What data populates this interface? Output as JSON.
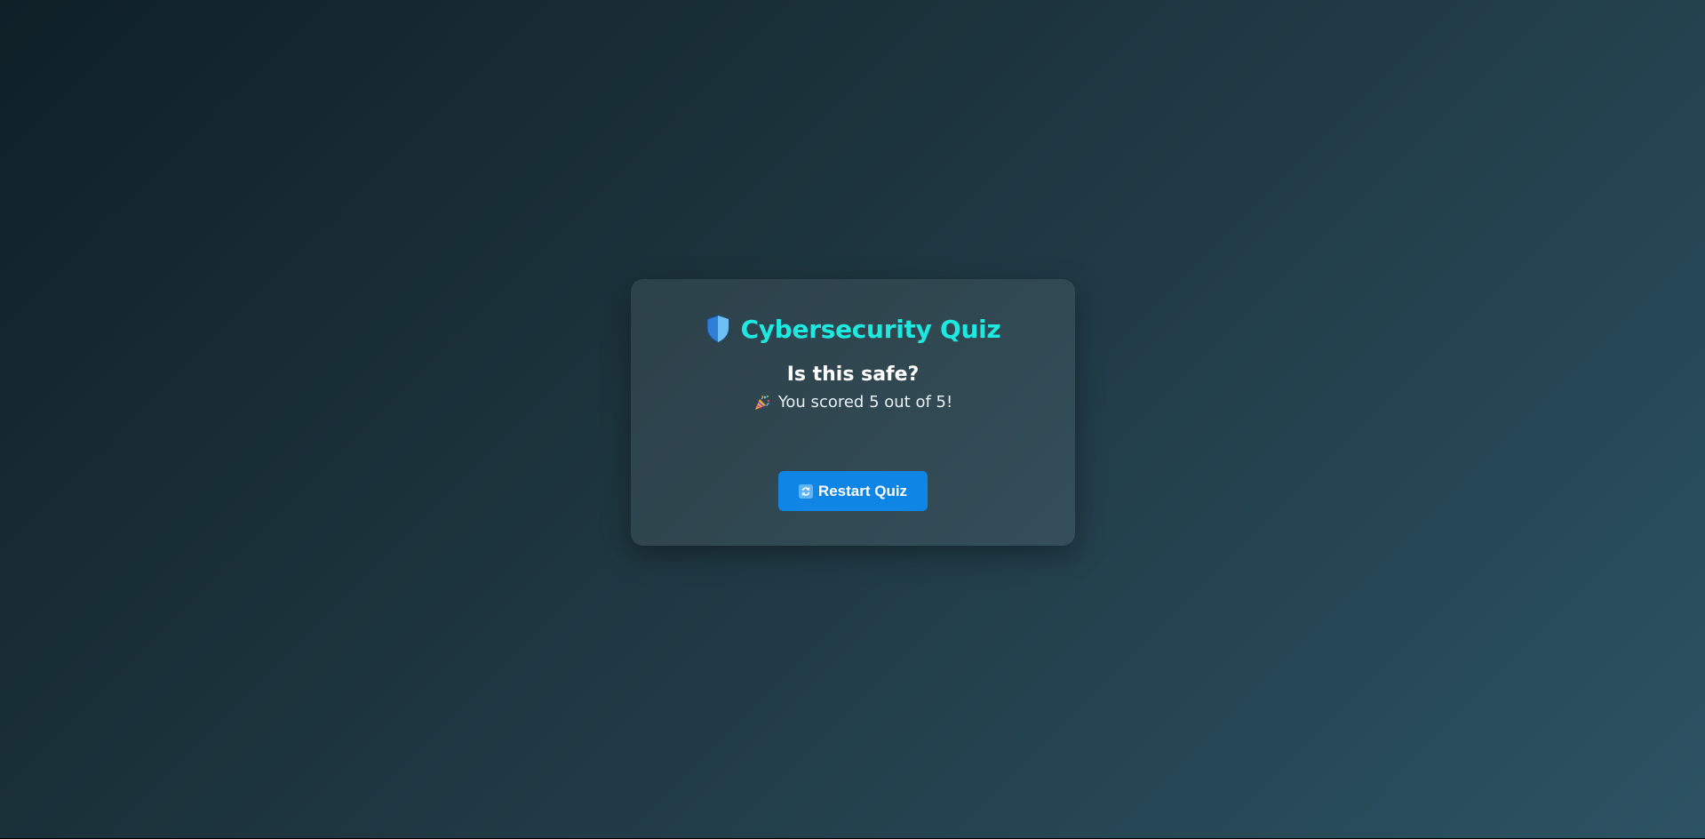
{
  "app": {
    "title": "Cybersecurity Quiz",
    "title_icon": "shield-icon"
  },
  "quiz": {
    "heading": "Is this safe?",
    "result_icon": "party-popper-icon",
    "result_text": "You scored 5 out of 5!",
    "score": 5,
    "total": 5
  },
  "actions": {
    "restart_icon": "restart-icon",
    "restart_label": "Restart Quiz"
  },
  "colors": {
    "title": "#1de9e0",
    "button": "#0f86e6",
    "background_start": "#0f2027",
    "background_end": "#2c5364"
  }
}
